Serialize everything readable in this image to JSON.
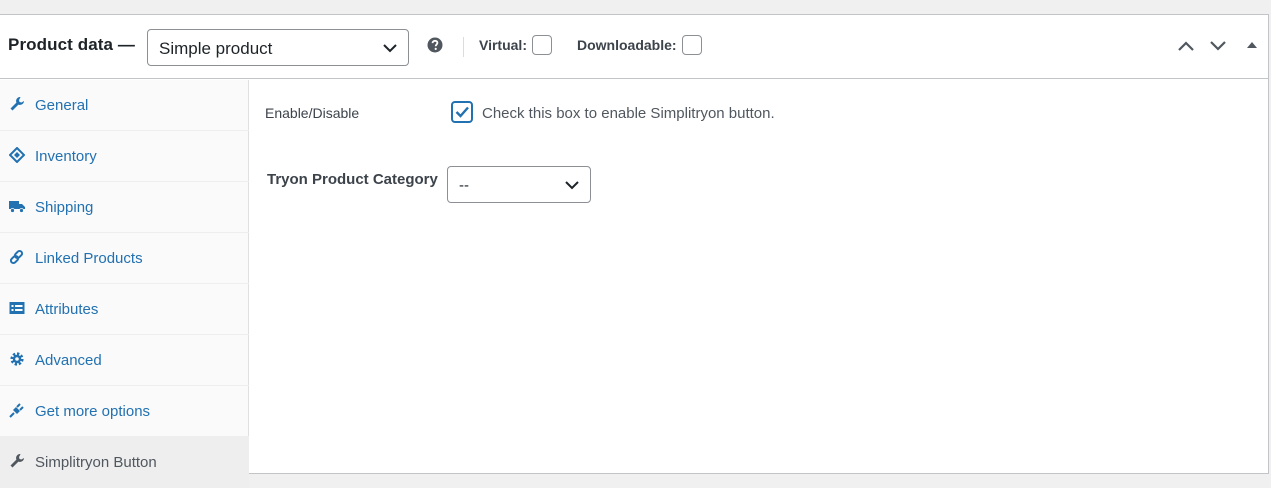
{
  "header": {
    "title": "Product data —",
    "product_type": "Simple product",
    "virtual_label": "Virtual:",
    "downloadable_label": "Downloadable:",
    "virtual_checked": false,
    "downloadable_checked": false
  },
  "tabs": [
    {
      "label": "General",
      "icon": "wrench-icon",
      "active": false
    },
    {
      "label": "Inventory",
      "icon": "tag-icon",
      "active": false
    },
    {
      "label": "Shipping",
      "icon": "truck-icon",
      "active": false
    },
    {
      "label": "Linked Products",
      "icon": "link-icon",
      "active": false
    },
    {
      "label": "Attributes",
      "icon": "list-icon",
      "active": false
    },
    {
      "label": "Advanced",
      "icon": "gear-icon",
      "active": false
    },
    {
      "label": "Get more options",
      "icon": "plug-icon",
      "active": false
    },
    {
      "label": "Simplitryon Button",
      "icon": "wrench-icon",
      "active": true
    }
  ],
  "main": {
    "enable_label": "Enable/Disable",
    "enable_checked": true,
    "enable_description": "Check this box to enable Simplitryon button.",
    "category_label": "Tryon Product Category",
    "category_value": "--"
  },
  "colors": {
    "link": "#2271b1",
    "active_tab_bg": "#eeeeee",
    "border": "#c3c4c7"
  }
}
